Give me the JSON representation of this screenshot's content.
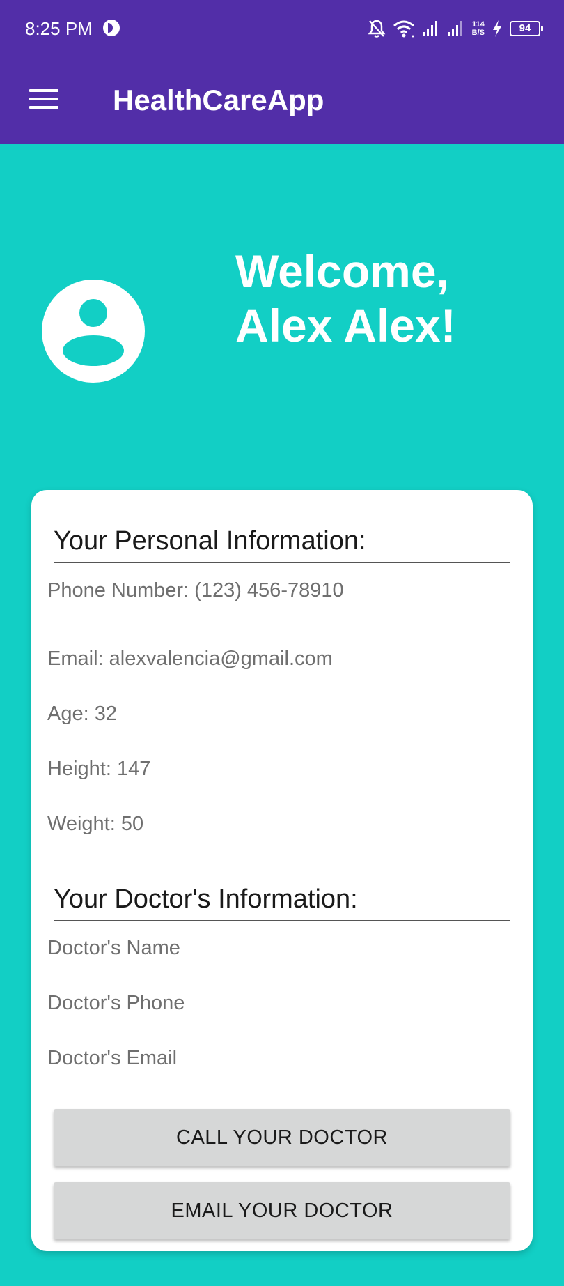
{
  "status_bar": {
    "time": "8:25 PM",
    "net_speed_value": "114",
    "net_speed_unit": "B/S",
    "battery_level": "94"
  },
  "app_bar": {
    "title": "HealthCareApp"
  },
  "hero": {
    "welcome_line1": "Welcome,",
    "welcome_line2": "Alex Alex!"
  },
  "personal_info": {
    "heading": "Your Personal Information:",
    "phone": "Phone Number: (123) 456-78910",
    "email": "Email: alexvalencia@gmail.com",
    "age": "Age: 32",
    "height": "Height: 147",
    "weight": "Weight: 50"
  },
  "doctor_info": {
    "heading": "Your Doctor's Information:",
    "name": "Doctor's Name",
    "phone": "Doctor's Phone",
    "email": "Doctor's Email"
  },
  "actions": {
    "call_label": "CALL YOUR DOCTOR",
    "email_label": "EMAIL YOUR DOCTOR"
  },
  "colors": {
    "app_bar": "#522ea8",
    "background": "#12cfc5",
    "card": "#ffffff",
    "button": "#d6d7d7"
  }
}
